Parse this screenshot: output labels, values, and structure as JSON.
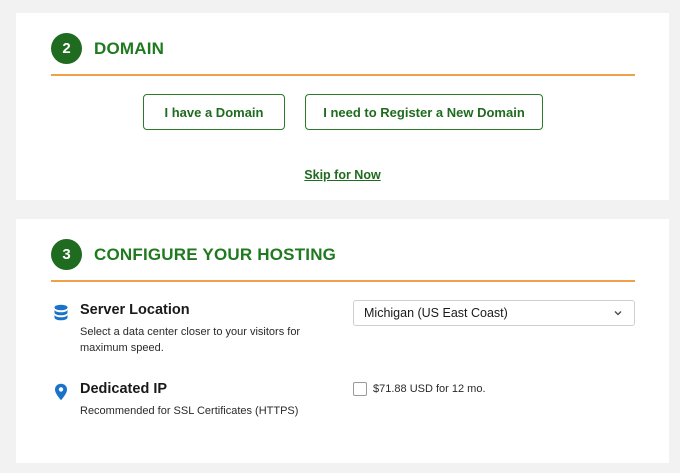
{
  "domain": {
    "step_number": "2",
    "title": "DOMAIN",
    "have_domain_label": "I have a Domain",
    "register_domain_label": "I need to Register a New Domain",
    "skip_label": "Skip for Now"
  },
  "hosting": {
    "step_number": "3",
    "title": "CONFIGURE YOUR HOSTING",
    "server_location": {
      "icon": "database-icon",
      "title": "Server Location",
      "description": "Select a data center closer to your visitors for maximum speed.",
      "selected": "Michigan (US East Coast)"
    },
    "dedicated_ip": {
      "icon": "map-pin-icon",
      "title": "Dedicated IP",
      "description": "Recommended for SSL Certificates (HTTPS)",
      "price_label": "$71.88 USD for 12 mo.",
      "checked": false
    }
  },
  "colors": {
    "accent_green": "#1f6b1f",
    "divider_orange": "#f0a04a",
    "icon_blue": "#1a73c9"
  }
}
